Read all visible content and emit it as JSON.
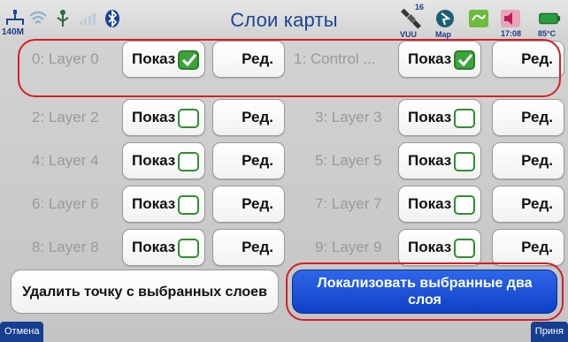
{
  "status": {
    "network_label": "140M",
    "gps_count": "16",
    "gps_label": "VUU",
    "map_label": "Map",
    "time": "17:08",
    "temperature": "85°C"
  },
  "title": "Слои карты",
  "show_label": "Показ",
  "edit_label": "Ред.",
  "layers": [
    {
      "label": "0: Layer 0",
      "shown": true
    },
    {
      "label": "1: Control ...",
      "shown": true
    },
    {
      "label": "2: Layer 2",
      "shown": false
    },
    {
      "label": "3: Layer 3",
      "shown": false
    },
    {
      "label": "4: Layer 4",
      "shown": false
    },
    {
      "label": "5: Layer 5",
      "shown": false
    },
    {
      "label": "6: Layer 6",
      "shown": false
    },
    {
      "label": "7: Layer 7",
      "shown": false
    },
    {
      "label": "8: Layer 8",
      "shown": false
    },
    {
      "label": "9: Layer 9",
      "shown": false
    }
  ],
  "actions": {
    "delete_point": "Удалить точку с выбранных слоев",
    "localize": "Локализовать выбранные два слоя"
  },
  "softkeys": {
    "cancel": "Отмена",
    "accept": "Приня"
  },
  "colors": {
    "accent": "#1a4596",
    "highlight": "#d61f26",
    "check": "#3ea33e"
  }
}
